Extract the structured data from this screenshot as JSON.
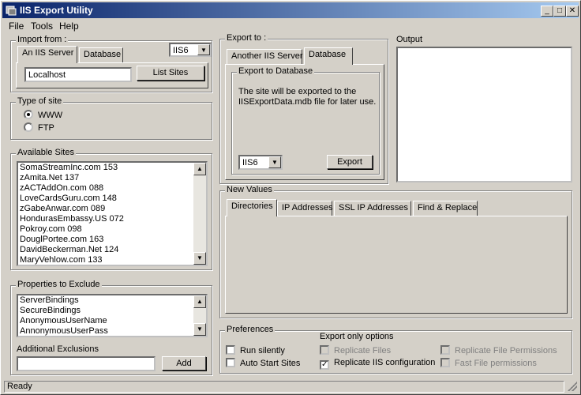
{
  "window": {
    "title": "IIS Export Utility",
    "minimize": "_",
    "maximize": "□",
    "close": "✕"
  },
  "menu": [
    {
      "label": "File"
    },
    {
      "label": "Tools"
    },
    {
      "label": "Help"
    }
  ],
  "import_from": {
    "label": "Import from :",
    "tabs": [
      "An IIS Server",
      "Database"
    ],
    "version": "IIS6",
    "server": "Localhost",
    "list_sites_button": "List Sites"
  },
  "type_of_site": {
    "label": "Type of site",
    "options": [
      "WWW",
      "FTP"
    ],
    "selected": "WWW"
  },
  "available_sites": {
    "label": "Available Sites",
    "items": [
      "SomaStreamInc.com 153",
      "zAmita.Net 137",
      "zACTAddOn.com 088",
      "LoveCardsGuru.com 148",
      "zGabeAnwar.com  089",
      "HondurasEmbassy.US 072",
      "Pokroy.com 098",
      "DouglPortee.com 163",
      "DavidBeckerman.Net 124",
      "MaryVehlow.com 133"
    ]
  },
  "properties_to_exclude": {
    "label": "Properties to Exclude",
    "items": [
      "ServerBindings",
      "SecureBindings",
      "AnonymousUserName",
      "AnnonymousUserPass"
    ],
    "additional_label": "Additional Exclusions",
    "additional_value": "",
    "add_button": "Add"
  },
  "export_to": {
    "label": "Export to :",
    "tabs": [
      "Another IIS Server",
      "Database"
    ],
    "group_label": "Export to Database",
    "description": "The site will be exported to the IISExportData.mdb file for later use.",
    "version": "IIS6",
    "export_button": "Export"
  },
  "output": {
    "label": "Output",
    "text": ""
  },
  "new_values": {
    "label": "New Values",
    "tabs": [
      "Directories",
      "IP Addresses",
      "SSL IP Addresses",
      "Find & Replace"
    ]
  },
  "preferences": {
    "label": "Preferences",
    "run_silently": "Run silently",
    "auto_start_sites": "Auto Start Sites",
    "export_only_label": "Export only options",
    "replicate_files": "Replicate Files",
    "replicate_iis_config": "Replicate IIS configuration",
    "replicate_file_permissions": "Replicate File Permissions",
    "fast_file_permissions": "Fast File permissions"
  },
  "status": {
    "text": "Ready"
  },
  "colors": {
    "face": "#d4d0c8",
    "title_start": "#0a246a",
    "title_end": "#a6caf0"
  }
}
